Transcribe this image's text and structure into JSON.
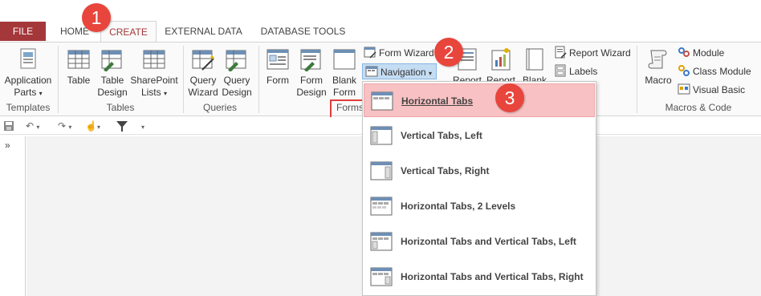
{
  "tabs": {
    "file": "FILE",
    "home": "HOME",
    "create": "CREATE",
    "external": "EXTERNAL DATA",
    "database": "DATABASE TOOLS"
  },
  "groups": {
    "templates": {
      "label": "Templates",
      "application_parts": [
        "Application",
        "Parts"
      ]
    },
    "tables": {
      "label": "Tables",
      "table": "Table",
      "table_design": [
        "Table",
        "Design"
      ],
      "sharepoint": [
        "SharePoint",
        "Lists"
      ]
    },
    "queries": {
      "label": "Queries",
      "query_wizard": [
        "Query",
        "Wizard"
      ],
      "query_design": [
        "Query",
        "Design"
      ]
    },
    "forms": {
      "label": "Forms",
      "form": "Form",
      "form_design": [
        "Form",
        "Design"
      ],
      "blank_form": [
        "Blank",
        "Form"
      ],
      "form_wizard": "Form Wizard",
      "navigation": "Navigation"
    },
    "reports": {
      "report": "Report",
      "report_design": "Report",
      "blank": "Blank",
      "report_wizard": "Report Wizard",
      "labels": "Labels"
    },
    "macros": {
      "label": "Macros & Code",
      "macro": "Macro",
      "module": "Module",
      "class_module": "Class Module",
      "visual_basic": "Visual Basic"
    }
  },
  "qat": {
    "chevron": "»"
  },
  "navigation_menu": [
    {
      "label": "Horizontal Tabs",
      "icon": "horizontal-tabs-icon"
    },
    {
      "label": "Vertical Tabs, Left",
      "icon": "vertical-tabs-left-icon"
    },
    {
      "label": "Vertical Tabs, Right",
      "icon": "vertical-tabs-right-icon"
    },
    {
      "label": "Horizontal Tabs, 2 Levels",
      "icon": "horizontal-tabs-2-levels-icon"
    },
    {
      "label": "Horizontal Tabs and Vertical Tabs, Left",
      "icon": "horizontal-vertical-left-icon"
    },
    {
      "label": "Horizontal Tabs and Vertical Tabs, Right",
      "icon": "horizontal-vertical-right-icon"
    }
  ],
  "callouts": [
    "1",
    "2",
    "3"
  ],
  "colors": {
    "accent": "#a4373a",
    "callout": "#e8453c",
    "highlight": "#f8c1c3",
    "nav_button": "#c5ddf3"
  }
}
